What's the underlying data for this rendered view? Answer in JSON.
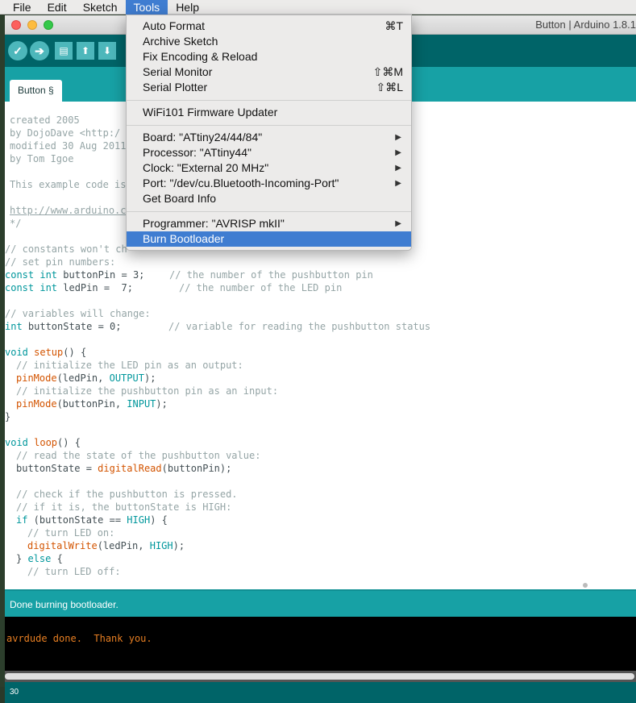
{
  "menubar": {
    "items": [
      "File",
      "Edit",
      "Sketch",
      "Tools",
      "Help"
    ],
    "active": "Tools"
  },
  "window": {
    "title": "Button | Arduino 1.8.1"
  },
  "toolbar": {
    "buttons": [
      "verify-icon",
      "upload-icon",
      "new-icon",
      "open-icon",
      "save-icon"
    ]
  },
  "tab": {
    "label": "Button §"
  },
  "tools_menu": {
    "group1": [
      {
        "label": "Auto Format",
        "shortcut": "⌘T"
      },
      {
        "label": "Archive Sketch",
        "shortcut": ""
      },
      {
        "label": "Fix Encoding & Reload",
        "shortcut": ""
      },
      {
        "label": "Serial Monitor",
        "shortcut": "⇧⌘M"
      },
      {
        "label": "Serial Plotter",
        "shortcut": "⇧⌘L"
      }
    ],
    "group2": [
      {
        "label": "WiFi101 Firmware Updater"
      }
    ],
    "group3": [
      {
        "label": "Board: \"ATtiny24/44/84\"",
        "submenu": true
      },
      {
        "label": "Processor: \"ATtiny44\"",
        "submenu": true
      },
      {
        "label": "Clock: \"External 20 MHz\"",
        "submenu": true
      },
      {
        "label": "Port: \"/dev/cu.Bluetooth-Incoming-Port\"",
        "submenu": true
      },
      {
        "label": "Get Board Info",
        "submenu": false
      }
    ],
    "group4": [
      {
        "label": "Programmer: \"AVRISP mkII\"",
        "submenu": true
      },
      {
        "label": "Burn Bootloader",
        "submenu": false,
        "highlighted": true
      }
    ]
  },
  "editor": {
    "header_comment": [
      "created 2005",
      "by DojoDave <http:/",
      "modified 30 Aug 2011",
      "by Tom Igoe",
      "",
      "This example code is",
      "",
      "http://www.arduino.c",
      "*/"
    ],
    "code": {
      "c1": "// constants won't ch",
      "c2": "// set pin numbers:",
      "l1_kw": "const int",
      "l1_rest": " buttonPin = 3;",
      "l1_cmt": "// the number of the pushbutton pin",
      "l2_kw": "const int",
      "l2_rest": " ledPin =  7;",
      "l2_cmt": "// the number of the LED pin",
      "c3": "// variables will change:",
      "l3_kw": "int",
      "l3_rest": " buttonState = 0;",
      "l3_cmt": "// variable for reading the pushbutton status",
      "setup_kw": "void",
      "setup_fn": " setup",
      "setup_rest": "() {",
      "s_c1": "// initialize the LED pin as an output:",
      "s_fn1": "pinMode",
      "s_a1": "(ledPin, ",
      "s_k1": "OUTPUT",
      "s_e1": ");",
      "s_c2": "// initialize the pushbutton pin as an input:",
      "s_fn2": "pinMode",
      "s_a2": "(buttonPin, ",
      "s_k2": "INPUT",
      "s_e2": ");",
      "close": "}",
      "loop_kw": "void",
      "loop_fn": " loop",
      "loop_rest": "() {",
      "lp_c1": "// read the state of the pushbutton value:",
      "lp_a": "buttonState = ",
      "lp_fn": "digitalRead",
      "lp_b": "(buttonPin);",
      "lp_c2": "// check if the pushbutton is pressed.",
      "lp_c3": "// if it is, the buttonState is HIGH:",
      "if_kw": "if",
      "if_a": " (buttonState == ",
      "if_k": "HIGH",
      "if_b": ") {",
      "lp_c4": "// turn LED on:",
      "dw_fn": "digitalWrite",
      "dw_a": "(ledPin, ",
      "dw_k": "HIGH",
      "dw_b": ");",
      "else_a": "} ",
      "else_kw": "else",
      "else_b": " {",
      "lp_c5": "// turn LED off:"
    }
  },
  "status": {
    "message": "Done burning bootloader."
  },
  "console": {
    "line": "avrdude done.  Thank you."
  },
  "footer": {
    "line_number": "30"
  }
}
